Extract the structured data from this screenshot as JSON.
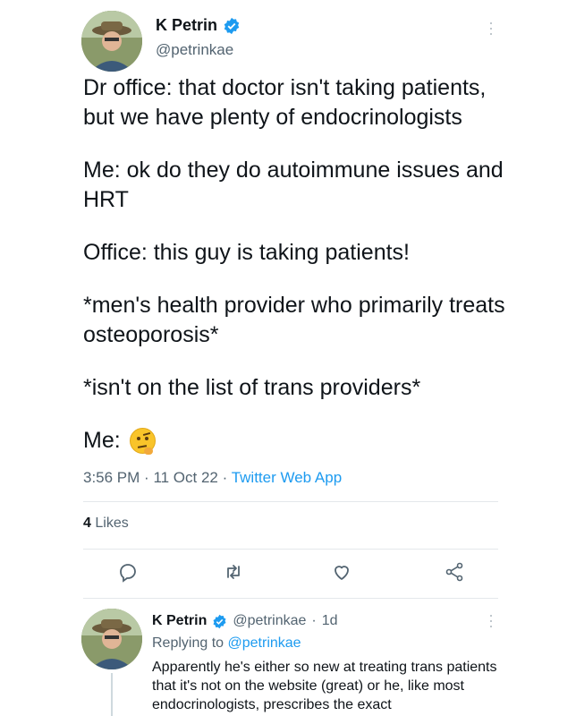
{
  "tweet": {
    "author_name": "K Petrin",
    "author_handle": "@petrinkae",
    "paragraphs": [
      "Dr office: that doctor isn't taking patients, but we have plenty of endocrinologists",
      "Me: ok do they do autoimmune issues and HRT",
      "Office: this guy is taking patients!",
      "*men's health provider who primarily treats osteoporosis*",
      "*isn't on the list of trans providers*"
    ],
    "last_line": "Me:",
    "emoji": "face-with-raised-eyebrow-emoji",
    "time": "3:56 PM",
    "date": "11 Oct 22",
    "source": "Twitter Web App",
    "likes_count": "4",
    "likes_label": "Likes"
  },
  "actions": {
    "reply_icon": "reply-icon",
    "retweet_icon": "retweet-icon",
    "like_icon": "heart-icon",
    "share_icon": "share-icon"
  },
  "reply": {
    "author_name": "K Petrin",
    "author_handle": "@petrinkae",
    "age": "1d",
    "replying_prefix": "Replying to",
    "replying_to": "@petrinkae",
    "text": "Apparently he's either so new at treating trans patients that it's not on the website (great) or he, like most endocrinologists, prescribes the exact"
  },
  "colors": {
    "accent": "#1d9bf0",
    "text": "#0f1419",
    "secondary": "#536471"
  }
}
